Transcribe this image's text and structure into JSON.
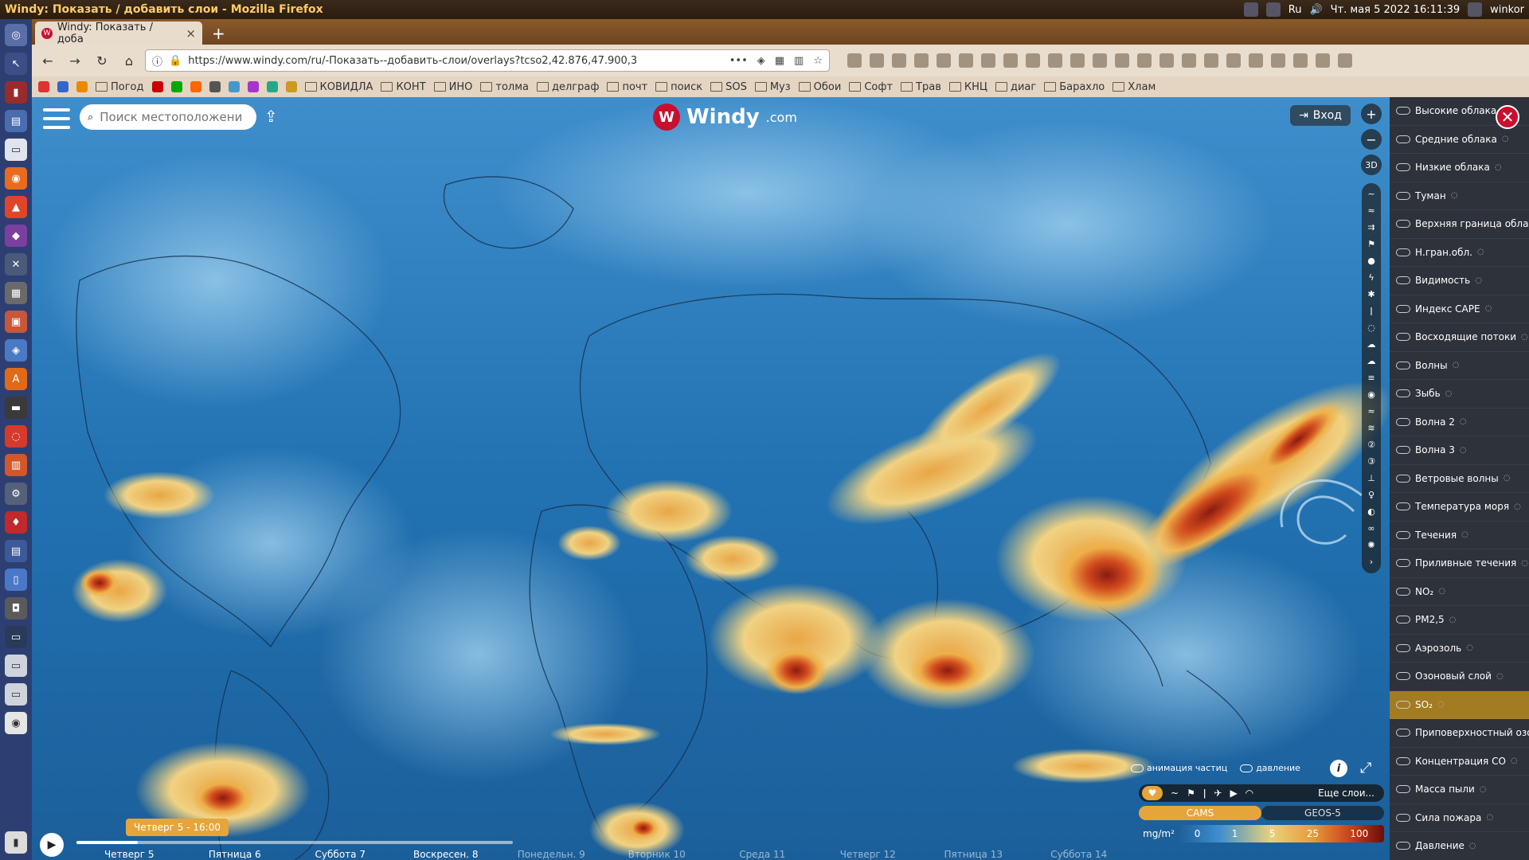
{
  "topbar": {
    "title": "Windy: Показать / добавить слои - Mozilla Firefox",
    "lang": "Ru",
    "clock": "Чт. мая 5 2022 16:11:39",
    "user": "winkor"
  },
  "tab": {
    "title": "Windy: Показать / доба",
    "close": "×",
    "new": "+"
  },
  "url": "https://www.windy.com/ru/-Показать--добавить-слои/overlays?tcso2,42.876,47.900,3",
  "bookmarks": [
    "Погод",
    "КОВИДЛА",
    "КОНТ",
    "ИНО",
    "толма",
    "делграф",
    "почт",
    "поиск",
    "SOS",
    "Муз",
    "Обои",
    "Софт",
    "Трав",
    "КНЦ",
    "диаг",
    "Барахло",
    "Хлам"
  ],
  "map": {
    "search_placeholder": "Поиск местоположения",
    "logo_text": "Windy",
    "logo_suffix": ".com",
    "login_label": "Вход",
    "three_d_label": "3D",
    "options": {
      "particles": "анимация частиц",
      "pressure": "давление"
    },
    "picker_more": "Еще слои...",
    "models": [
      "CAMS",
      "GEOS-5"
    ],
    "scale": {
      "unit": "mg/m²",
      "ticks": [
        "0",
        "1",
        "5",
        "25",
        "100"
      ]
    },
    "timeline": {
      "current": "Четверг 5 - 16:00",
      "progress": 0.14,
      "days": [
        {
          "label": "Четверг 5",
          "active": true
        },
        {
          "label": "Пятница 6",
          "active": true
        },
        {
          "label": "Суббота 7",
          "active": true
        },
        {
          "label": "Воскресен. 8",
          "active": true
        },
        {
          "label": "Понедельн. 9",
          "active": false
        },
        {
          "label": "Вторник 10",
          "active": false
        },
        {
          "label": "Среда 11",
          "active": false
        },
        {
          "label": "Четверг 12",
          "active": false
        },
        {
          "label": "Пятница 13",
          "active": false
        },
        {
          "label": "Суббота 14",
          "active": false
        }
      ]
    }
  },
  "layers": [
    {
      "label": "Высокие облака",
      "icon": "cloud-icon"
    },
    {
      "label": "Средние облака",
      "icon": "cloud-icon"
    },
    {
      "label": "Низкие облака",
      "icon": "cloud-icon"
    },
    {
      "label": "Туман",
      "icon": "fog-icon"
    },
    {
      "label": "Верхняя граница облак",
      "icon": "cloud-top-icon"
    },
    {
      "label": "Н.гран.обл.",
      "icon": "cloud-base-icon"
    },
    {
      "label": "Видимость",
      "icon": "eye-icon"
    },
    {
      "label": "Индекс CAPE",
      "icon": "cape-icon"
    },
    {
      "label": "Восходящие потоки",
      "icon": "updraft-icon"
    },
    {
      "label": "Волны",
      "icon": "waves-icon"
    },
    {
      "label": "Зыбь",
      "icon": "swell-icon"
    },
    {
      "label": "Волна 2",
      "icon": "wave2-icon"
    },
    {
      "label": "Волна 3",
      "icon": "wave3-icon"
    },
    {
      "label": "Ветровые волны",
      "icon": "wind-waves-icon"
    },
    {
      "label": "Температура моря",
      "icon": "thermometer-icon"
    },
    {
      "label": "Течения",
      "icon": "currents-icon"
    },
    {
      "label": "Приливные течения",
      "icon": "tide-icon"
    },
    {
      "label": "NO₂",
      "icon": "factory-icon"
    },
    {
      "label": "PM2,5",
      "icon": "particles-icon"
    },
    {
      "label": "Аэрозоль",
      "icon": "aerosol-icon"
    },
    {
      "label": "Озоновый слой",
      "icon": "ozone-icon"
    },
    {
      "label": "SO₂",
      "icon": "volcano-icon",
      "active": true
    },
    {
      "label": "Приповерхностный озо",
      "icon": "ozone-icon"
    },
    {
      "label": "Концентрация CO",
      "icon": "co-icon"
    },
    {
      "label": "Масса пыли",
      "icon": "dust-icon"
    },
    {
      "label": "Сила пожара",
      "icon": "fire-icon"
    },
    {
      "label": "Давление",
      "icon": "pressure-icon"
    }
  ],
  "colors": {
    "accent": "#e6a53a",
    "active_layer": "#a37b23",
    "windy_red": "#c8102e",
    "ocean": "#1f6aa8"
  }
}
